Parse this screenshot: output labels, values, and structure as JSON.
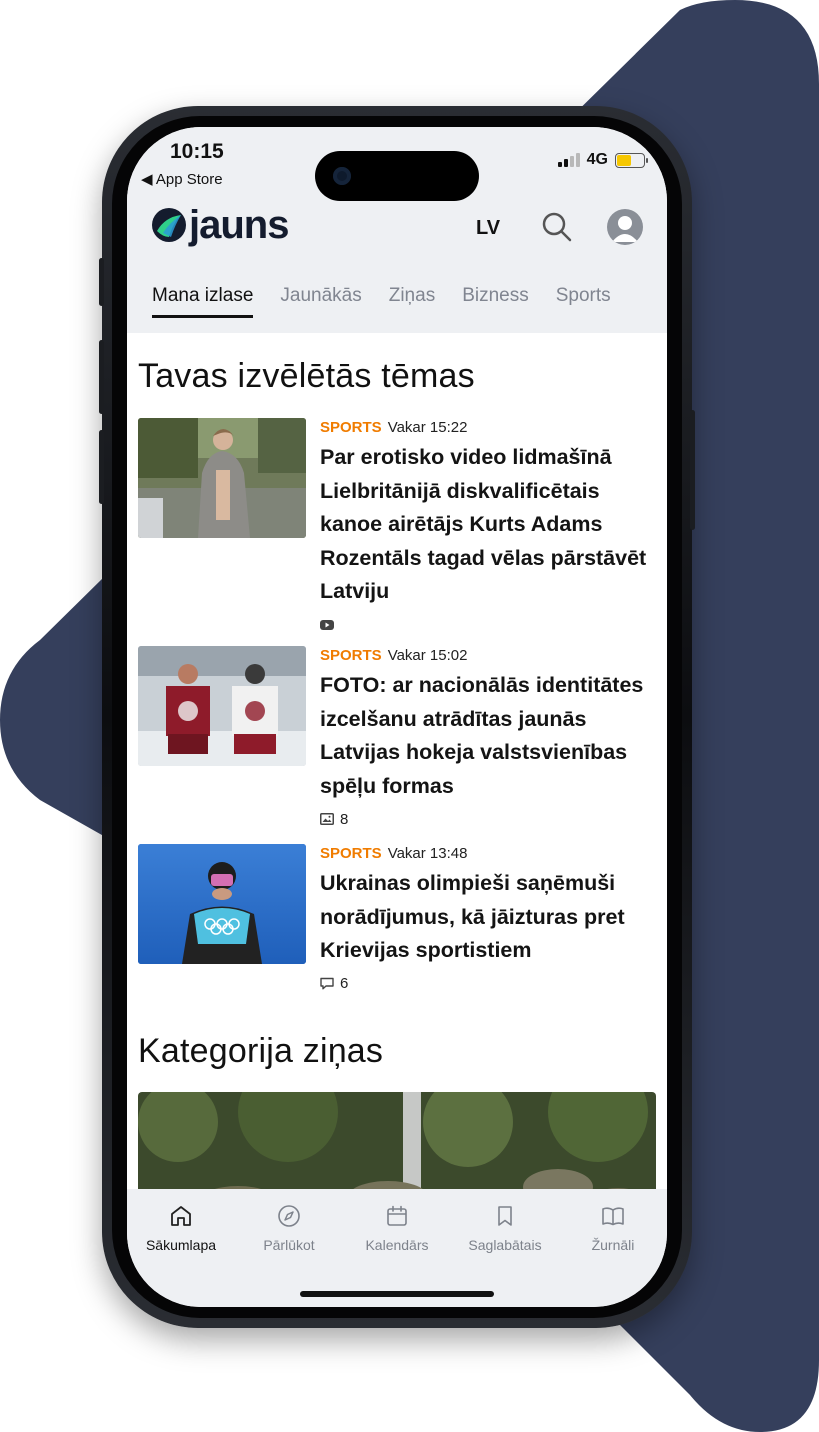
{
  "status": {
    "time": "10:15",
    "back_app": "App Store",
    "network": "4G"
  },
  "header": {
    "logo_text": "jauns",
    "language": "LV",
    "icons": [
      "search-icon",
      "user-avatar-icon"
    ]
  },
  "tabs": [
    {
      "label": "Mana izlase",
      "active": true
    },
    {
      "label": "Jaunākās",
      "active": false
    },
    {
      "label": "Ziņas",
      "active": false
    },
    {
      "label": "Bizness",
      "active": false
    },
    {
      "label": "Sports",
      "active": false
    }
  ],
  "section1": {
    "title": "Tavas izvēlētās tēmas",
    "articles": [
      {
        "category": "SPORTS",
        "time": "Vakar 15:22",
        "headline": "Par erotisko video lidmašīnā Lielbritānijā diskvalificētais kanoe airētājs Kurts Adams Rozentāls tagad vēlas pārstāvēt Latviju",
        "extra_icon": "video-icon",
        "extra_value": ""
      },
      {
        "category": "SPORTS",
        "time": "Vakar 15:02",
        "headline": "FOTO: ar nacionālās identitātes izcelšanu atrādītas jaunās Latvijas hokeja valstsvienības spēļu formas",
        "extra_icon": "gallery-icon",
        "extra_value": "8"
      },
      {
        "category": "SPORTS",
        "time": "Vakar 13:48",
        "headline": "Ukrainas olimpieši saņēmuši norādījumus, kā jāizturas pret Krievijas sportistiem",
        "extra_icon": "comment-icon",
        "extra_value": "6"
      }
    ]
  },
  "section2": {
    "title": "Kategorija ziņas"
  },
  "bottom_nav": [
    {
      "label": "Sākumlapa",
      "icon": "home-icon",
      "active": true
    },
    {
      "label": "Pārlūkot",
      "icon": "compass-icon",
      "active": false
    },
    {
      "label": "Kalendārs",
      "icon": "calendar-icon",
      "active": false
    },
    {
      "label": "Saglabātais",
      "icon": "bookmark-icon",
      "active": false
    },
    {
      "label": "Žurnāli",
      "icon": "book-icon",
      "active": false
    }
  ],
  "colors": {
    "accent_category": "#f07c00",
    "background_shape": "#353f5c",
    "header_bg": "#eef0f3"
  }
}
